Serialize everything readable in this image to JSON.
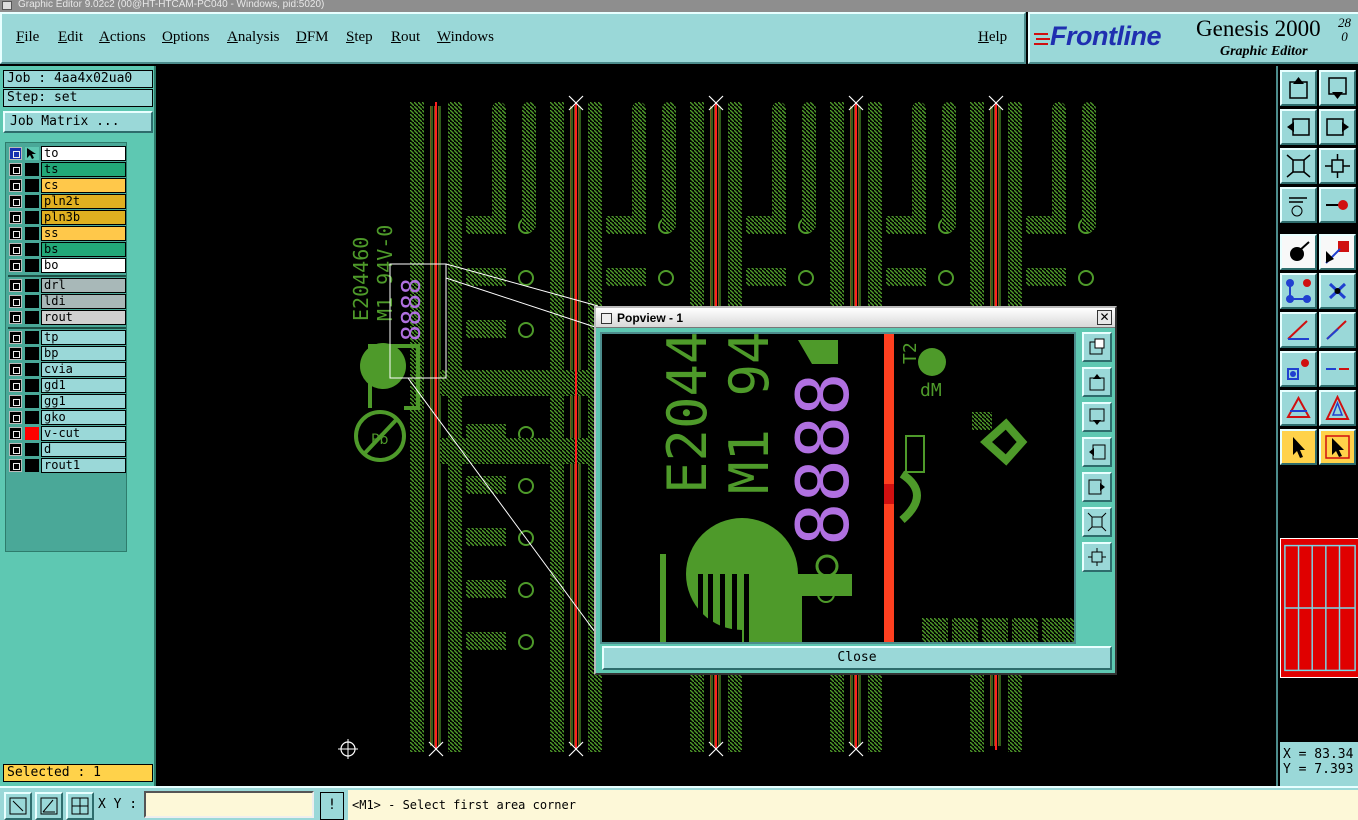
{
  "window": {
    "title": "Graphic Editor 9.02c2 (00@HT-HTCAM-PC040 - Windows, pid:5020)"
  },
  "menu": {
    "items": [
      "File",
      "Edit",
      "Actions",
      "Options",
      "Analysis",
      "DFM",
      "Step",
      "Rout",
      "Windows"
    ],
    "help": "Help"
  },
  "logo": {
    "brand": "Frontline",
    "product": "Genesis 2000",
    "subtitle": "Graphic Editor",
    "version_top": "28",
    "version_bottom": "0"
  },
  "left_panel": {
    "job": "Job : 4aa4x02ua0",
    "step": "Step: set",
    "job_matrix_button": "Job Matrix ...",
    "layers": [
      {
        "name": "to",
        "color": "#ffffff",
        "swatch": "#5ec8b2",
        "active": true
      },
      {
        "name": "ts",
        "color": "#22a878",
        "swatch": "#000000"
      },
      {
        "name": "cs",
        "color": "#ffc84a",
        "swatch": "#000000"
      },
      {
        "name": "pln2t",
        "color": "#e0b020",
        "swatch": "#000000"
      },
      {
        "name": "pln3b",
        "color": "#e0b020",
        "swatch": "#000000"
      },
      {
        "name": "ss",
        "color": "#ffc84a",
        "swatch": "#000000"
      },
      {
        "name": "bs",
        "color": "#22a878",
        "swatch": "#000000"
      },
      {
        "name": "bo",
        "color": "#ffffff",
        "swatch": "#000000"
      },
      {
        "name": "drl",
        "color": "#a8b8b8",
        "swatch": "#000000"
      },
      {
        "name": "ldi",
        "color": "#a8b8b8",
        "swatch": "#000000"
      },
      {
        "name": "rout",
        "color": "#d0d0d0",
        "swatch": "#000000"
      },
      {
        "name": "tp",
        "color": "#9ad8d8",
        "swatch": "#000000"
      },
      {
        "name": "bp",
        "color": "#9ad8d8",
        "swatch": "#000000"
      },
      {
        "name": "cvia",
        "color": "#9ad8d8",
        "swatch": "#000000"
      },
      {
        "name": "gd1",
        "color": "#9ad8d8",
        "swatch": "#000000"
      },
      {
        "name": "gg1",
        "color": "#9ad8d8",
        "swatch": "#000000"
      },
      {
        "name": "gko",
        "color": "#9ad8d8",
        "swatch": "#000000"
      },
      {
        "name": "v-cut",
        "color": "#9ad8d8",
        "swatch": "#ff0000"
      },
      {
        "name": "d",
        "color": "#9ad8d8",
        "swatch": "#000000"
      },
      {
        "name": "rout1",
        "color": "#9ad8d8",
        "swatch": "#000000"
      }
    ],
    "selected": "Selected : 1"
  },
  "popview": {
    "title": "Popview - 1",
    "close_x": "✕",
    "close_button": "Close"
  },
  "board": {
    "marking_line1": "E204460",
    "marking_line2": "M1 94V-0",
    "date_code": "8888",
    "silk_small": "dM",
    "silk_small2": "T2"
  },
  "coords": {
    "x": "X = 83.34",
    "y": "Y = 7.393"
  },
  "status": {
    "xy_label": "X Y :",
    "xy_value": "",
    "excl": "!",
    "prompt": "<M1> - Select first area corner"
  },
  "colors": {
    "panel_bg": "#9ad8d8",
    "side_bg": "#5ec8b2",
    "board_green": "#4e9a2a",
    "vcut_red": "#ff2020",
    "datecode_purple": "#b070e0"
  }
}
